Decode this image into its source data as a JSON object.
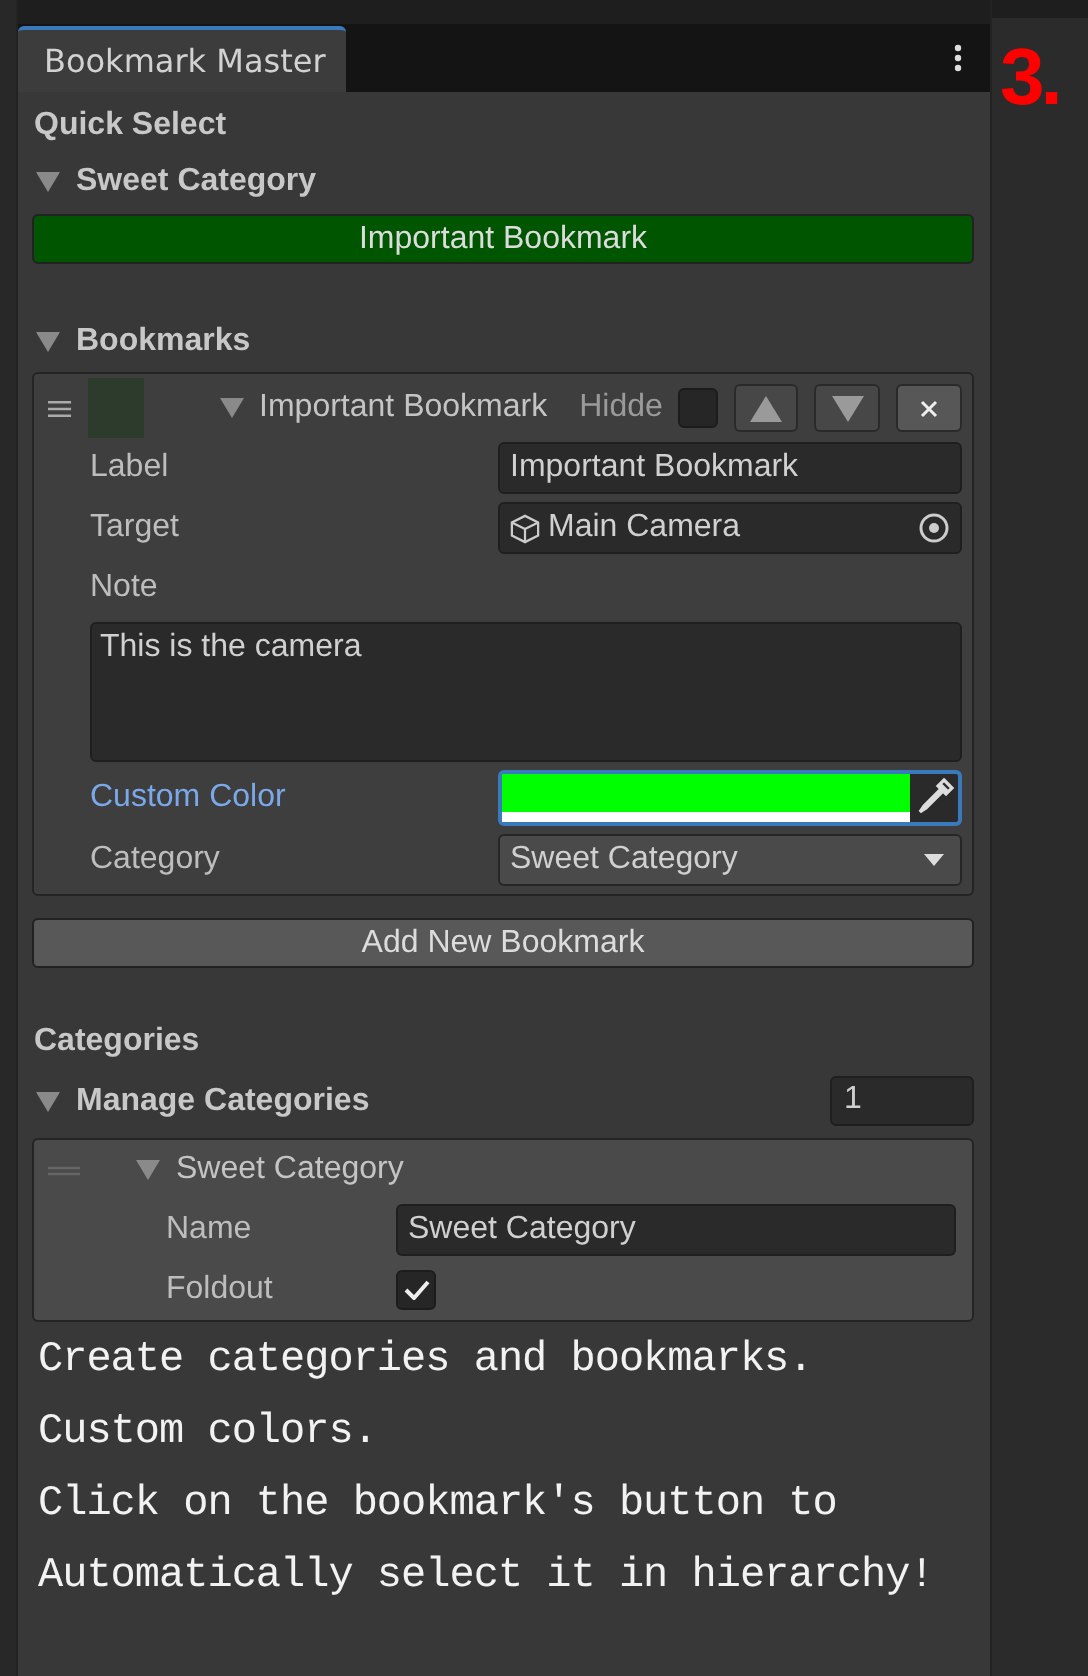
{
  "window": {
    "tab": "Bookmark Master",
    "step": "3."
  },
  "quick_select": {
    "title": "Quick Select",
    "categories": [
      {
        "name": "Sweet Category",
        "expanded": true,
        "buttons": [
          {
            "label": "Important Bookmark",
            "color": "#005500"
          }
        ]
      }
    ]
  },
  "bookmarks": {
    "title": "Bookmarks",
    "expanded": true,
    "items": [
      {
        "title": "Important Bookmark",
        "expanded": true,
        "hide_label": "Hidde",
        "hidden": false,
        "label_caption": "Label",
        "label": "Important Bookmark",
        "target_caption": "Target",
        "target": "Main Camera",
        "note_caption": "Note",
        "note": "This is the camera",
        "color_caption": "Custom Color",
        "color": "#00ff00",
        "category_caption": "Category",
        "category": "Sweet Category"
      }
    ]
  },
  "add_button": "Add New Bookmark",
  "categories": {
    "title": "Categories",
    "manage_title": "Manage Categories",
    "expanded": true,
    "count": "1",
    "items": [
      {
        "title": "Sweet Category",
        "expanded": true,
        "name_caption": "Name",
        "name": "Sweet Category",
        "foldout_caption": "Foldout",
        "foldout": true
      }
    ]
  },
  "caption": [
    "Create categories and bookmarks.",
    "Custom colors.",
    "Click on the bookmark's button to",
    "Automatically select it in hierarchy!"
  ]
}
